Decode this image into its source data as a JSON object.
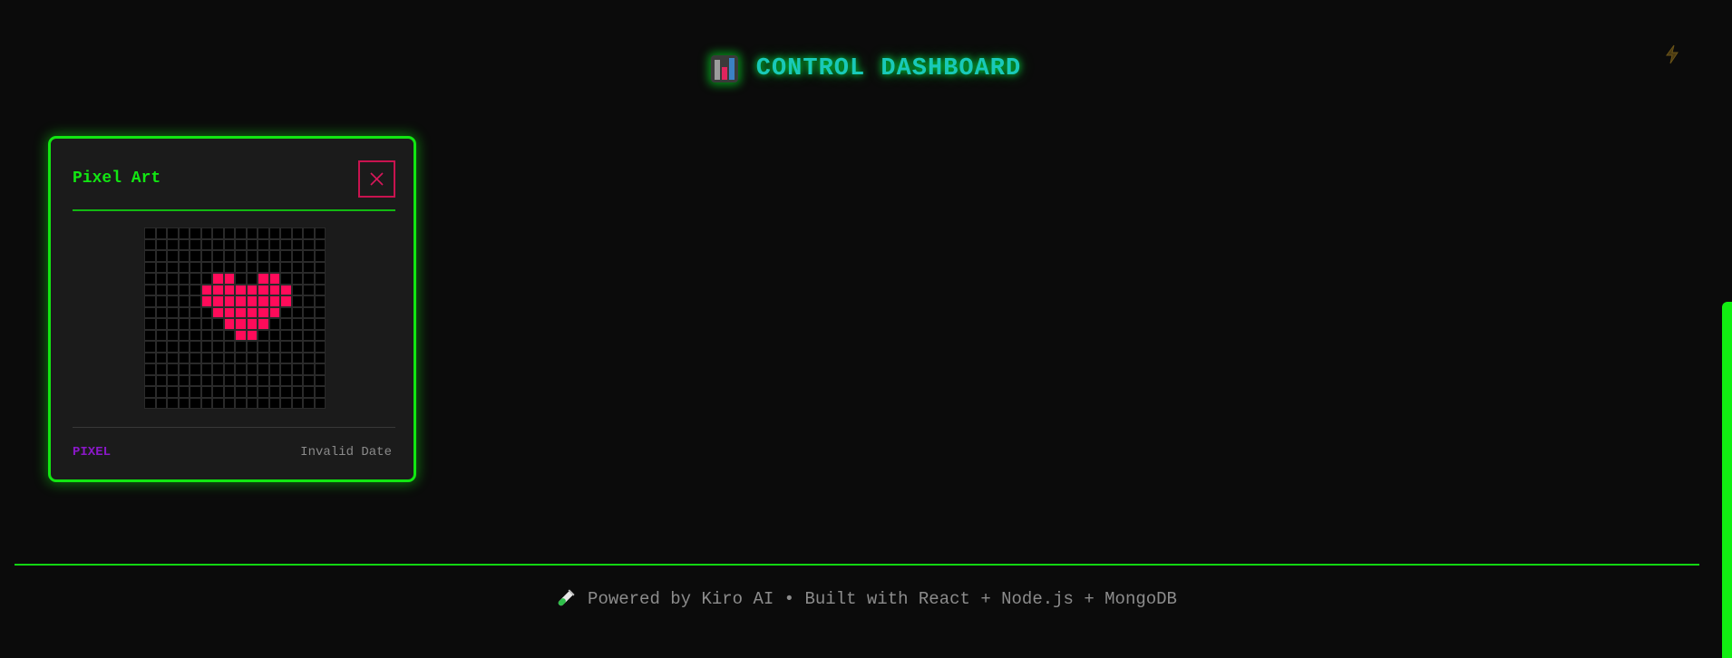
{
  "header": {
    "icon": "bar-chart-icon",
    "title": "CONTROL DASHBOARD",
    "bolt_icon": "lightning-bolt-icon"
  },
  "card": {
    "title": "Pixel Art",
    "close_icon": "close-icon",
    "tag": "PIXEL",
    "date": "Invalid Date",
    "pixel_grid": {
      "size": 16,
      "on_color": "#ff0b5a",
      "off_color": "#000000",
      "rows": [
        "................",
        "................",
        "................",
        "................",
        "......##..##....",
        ".....########...",
        ".....########...",
        "......######....",
        ".......####.....",
        "........##......",
        "................",
        "................",
        "................",
        "................",
        "................",
        "................"
      ]
    }
  },
  "footer": {
    "icon": "test-tube-icon",
    "text": "Powered by Kiro AI • Built with React + Node.js + MongoDB"
  },
  "colors": {
    "background": "#0b0b0b",
    "accent_green": "#12e612",
    "title_teal": "#19c9b9",
    "close_red": "#c8134f",
    "tag_purple": "#8a18c8",
    "muted_text": "#8c8c8c"
  }
}
